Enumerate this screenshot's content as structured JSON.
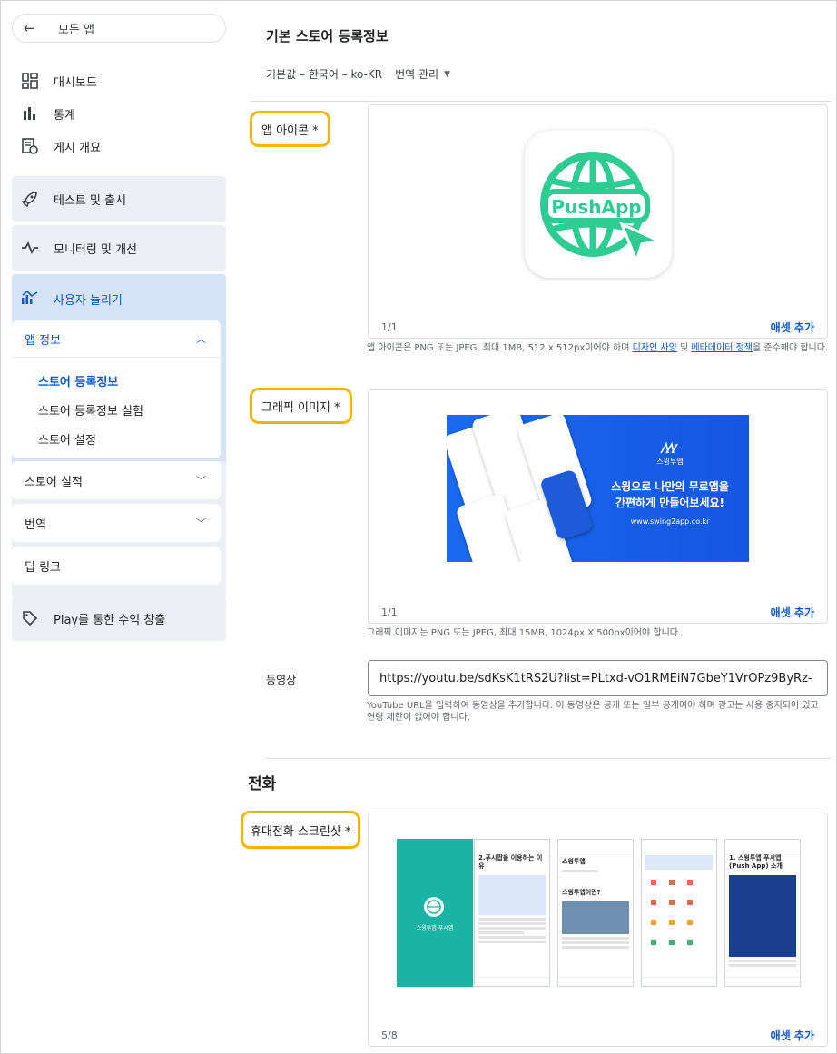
{
  "sidebar": {
    "back_label": "모든 앱",
    "items": [
      {
        "label": "대시보드",
        "icon": "dashboard-icon"
      },
      {
        "label": "통계",
        "icon": "bar-chart-icon"
      },
      {
        "label": "게시 개요",
        "icon": "publishing-overview-icon"
      }
    ],
    "sections": [
      {
        "label": "테스트 및 출시",
        "icon": "rocket-icon"
      },
      {
        "label": "모니터링 및 개선",
        "icon": "monitoring-icon"
      },
      {
        "label": "사용자 늘리기",
        "icon": "grow-users-icon"
      }
    ],
    "app_info": {
      "label": "앱 정보",
      "sub_items": [
        "스토어 등록정보",
        "스토어 등록정보 실험",
        "스토어 설정"
      ]
    },
    "store_performance": "스토어 실적",
    "translation": "번역",
    "deep_links": "딥 링크",
    "monetize": {
      "label": "Play를 통한 수익 창출",
      "icon": "tag-icon"
    }
  },
  "main": {
    "title": "기본 스토어 등록정보",
    "language": "기본값 – 한국어 – ko-KR",
    "manage_translations": "번역 관리",
    "app_icon": {
      "label": "앱 아이콘  *",
      "icon_text": "PushApp",
      "count": "1/1",
      "add": "애셋 추가",
      "help_prefix": "앱 아이콘은 PNG 또는 JPEG, 최대 1MB, 512 x 512px이어야 하며 ",
      "help_link1": "디자인 사양",
      "help_mid": " 및 ",
      "help_link2": "메타데이터 정책",
      "help_suffix": "을 준수해야 합니다."
    },
    "feature_graphic": {
      "label": "그래픽 이미지  *",
      "banner_line1": "스윙으로 나만의 무료앱을",
      "banner_line2": "간편하게 만들어보세요!",
      "banner_url": "www.swing2app.co.kr",
      "banner_logo": "스윙투앱",
      "count": "1/1",
      "add": "애셋 추가",
      "help": "그래픽 이미지는 PNG 또는 JPEG, 최대 15MB, 1024px X 500px이어야 합니다."
    },
    "video": {
      "label": "동영상",
      "value": "https://youtu.be/sdKsK1tRS2U?list=PLtxd-vO1RMEiN7GbeY1VrOPz9ByRz-",
      "help": "YouTube URL을 입력하여 동영상을 추가합니다. 이 동영상은 공개 또는 일부 공개여야 하며 광고는 사용 중지되어 있고 연령 제한이 없어야 합니다."
    },
    "phone_heading": "전화",
    "phone_screenshots": {
      "label": "휴대전화 스크린샷  *",
      "count": "5/8",
      "add": "애셋 추가",
      "shots": [
        {
          "title": "스윙투앱 푸시앱"
        },
        {
          "title": "2.푸시팝을 이용하는 이유"
        },
        {
          "title": "스윙투앱"
        },
        {
          "title": "스윙투앱이란?"
        },
        {
          "title": "1. 스윙투앱 푸시앱(Push App) 소개"
        }
      ]
    }
  },
  "colors": {
    "accent": "#0b57d0",
    "highlight": "#f6b600",
    "icon_green": "#2ecc93",
    "banner_blue": "#1a6af0"
  }
}
